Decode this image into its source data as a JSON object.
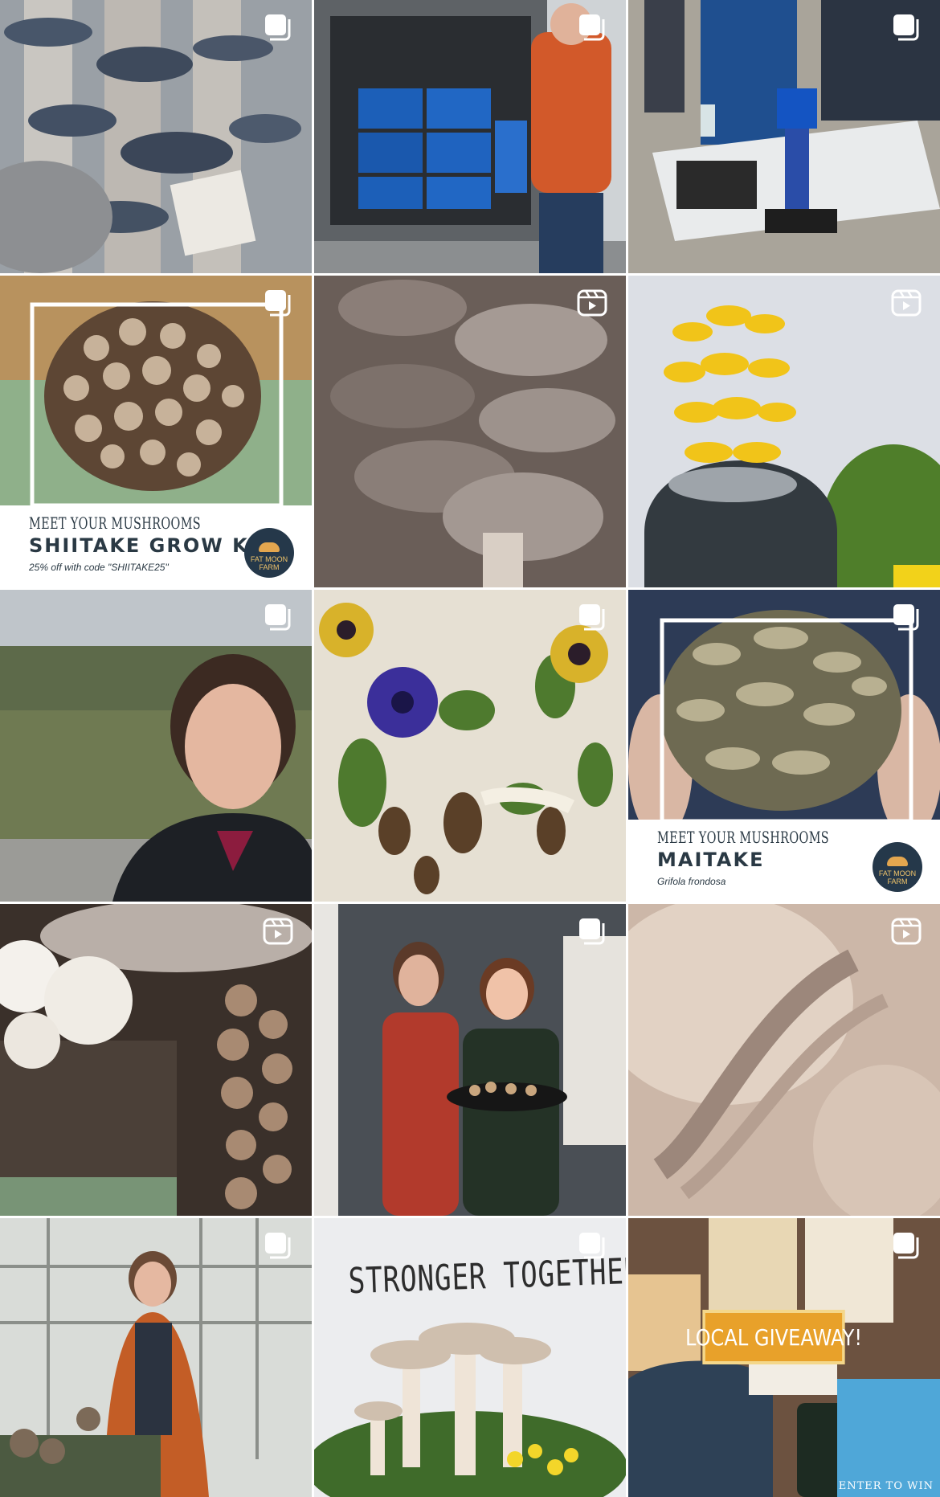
{
  "posts": [
    {
      "subject": "oyster-mushrooms",
      "icon": "carousel-icon"
    },
    {
      "subject": "van-delivery",
      "icon": "carousel-icon"
    },
    {
      "subject": "microscope-table",
      "icon": "carousel-icon"
    },
    {
      "subject": "shiitake-grow-kit",
      "icon": "carousel-icon",
      "kicker": "MEET YOUR MUSHROOMS",
      "title": "SHIITAKE GROW KIT",
      "subtitle": "25% off with code \"SHIITAKE25\""
    },
    {
      "subject": "shiitake-closeup",
      "icon": "reel-icon"
    },
    {
      "subject": "golden-oyster",
      "icon": "reel-icon"
    },
    {
      "subject": "selfie",
      "icon": "carousel-icon"
    },
    {
      "subject": "pansies-morels",
      "icon": "carousel-icon"
    },
    {
      "subject": "maitake",
      "icon": "carousel-icon",
      "kicker": "MEET YOUR MUSHROOMS",
      "title": "MAITAKE",
      "subtitle": "Grifola frondosa"
    },
    {
      "subject": "lions-mane-shiitake",
      "icon": "reel-icon"
    },
    {
      "subject": "two-women-tray",
      "icon": "carousel-icon"
    },
    {
      "subject": "gills-closeup",
      "icon": "reel-icon"
    },
    {
      "subject": "greenhouse",
      "icon": "carousel-icon"
    },
    {
      "subject": "stronger-together",
      "icon": "carousel-icon",
      "title": "STRONGER TOGETHER"
    },
    {
      "subject": "local-giveaway",
      "icon": "carousel-icon",
      "title": "LOCAL GIVEAWAY!",
      "footer": "ENTER TO WIN"
    }
  ],
  "logo": {
    "line1": "FAT MOON",
    "line2": "FARM"
  },
  "colors": {
    "navy": "#2a3944",
    "accent": "#e8a12a"
  }
}
